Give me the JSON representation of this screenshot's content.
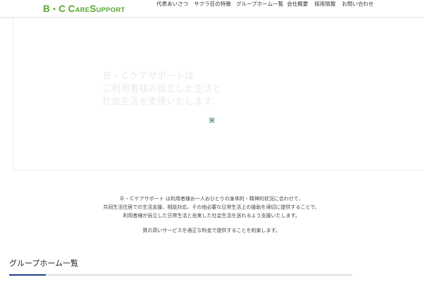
{
  "header": {
    "logo": {
      "b": "B",
      "sep": "・",
      "c": "C",
      "care_c": "C",
      "care_rest": "ARE",
      "sup_s": "S",
      "sup_rest": "UPPORT"
    },
    "nav": [
      "代表あいさつ",
      "サクラ荘の特徴",
      "グループホーム一覧",
      "会社概要",
      "採用情報",
      "お問い合わせ"
    ]
  },
  "hero": {
    "lines": [
      "Ｂ・Ｃケアサポートは",
      "ご利用者様の自立した生活と",
      "社会生活を支援いたします。"
    ]
  },
  "intro": {
    "paragraph_lines": [
      "Ｂ・Ｃケアサポート は利用者様お一人おひとりの身体的・精神的状況に合わせて、",
      "共同生活住居での生活支援、相談対応、その他必要な日常生活上の援助を適切に提供することで、",
      "利用者様が自立した日常生活と充実した社会生活を送れるよう支援いたします。"
    ],
    "closing": "質の高いサービスを適正な料金で提供することを約束します。"
  },
  "section": {
    "title": "グループホーム一覧"
  },
  "colors": {
    "brand_green": "#5aa531",
    "accent_navy": "#1f3f8f",
    "hero_text": "#e9e9e9"
  }
}
